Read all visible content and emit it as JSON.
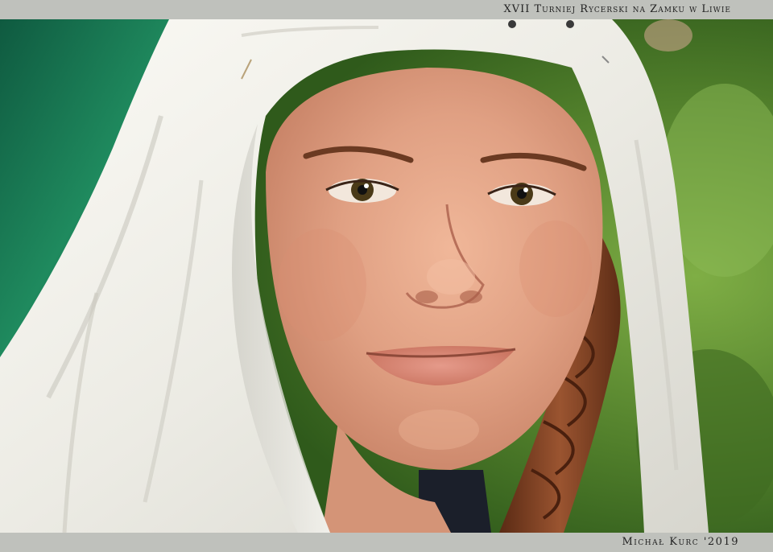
{
  "caption": {
    "title": "XVII Turniej Rycerski na Zamku w Liwie",
    "credit": "Michał Kurc '2019"
  },
  "photo": {
    "subject": "smiling young woman in white linen veil with brown braid",
    "colors": {
      "frame": "#bfc1bc",
      "veil": "#f1efe8",
      "skin": "#e3a486",
      "hair": "#7a3f22",
      "background_green": "#5f8f35",
      "background_teal": "#1f7f5a"
    }
  }
}
